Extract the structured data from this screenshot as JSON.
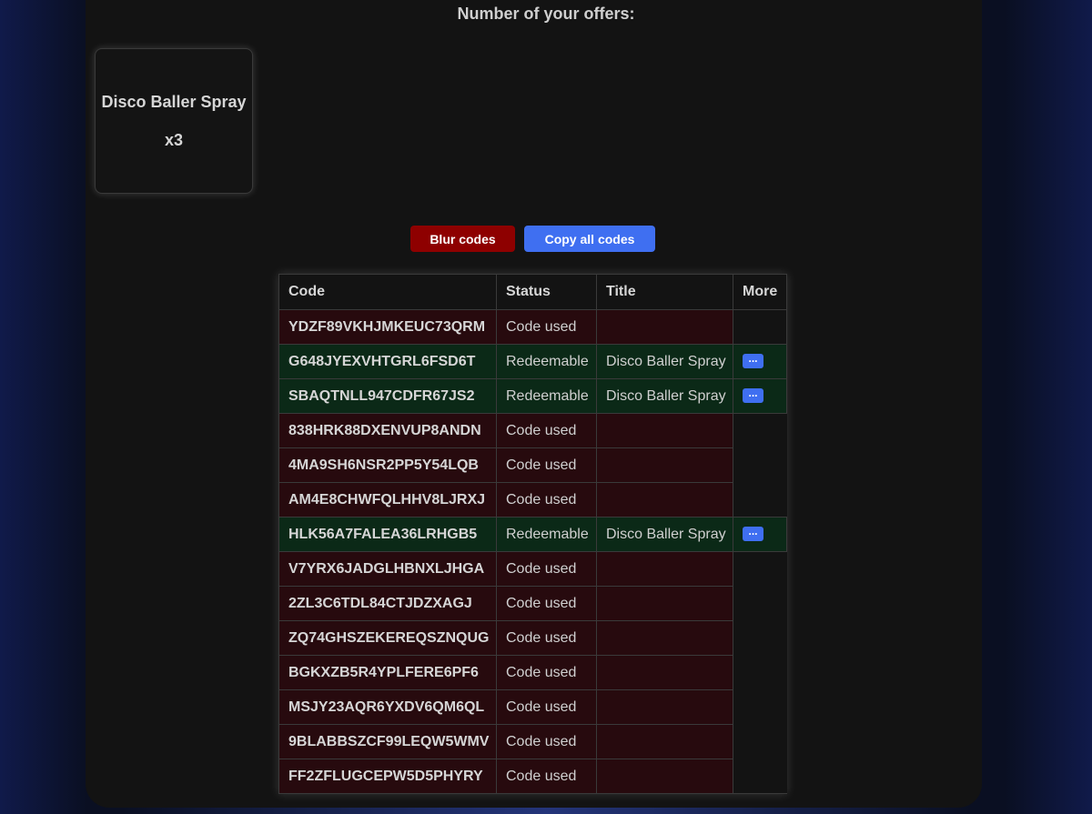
{
  "heading": "Number of your offers:",
  "offer": {
    "title": "Disco Baller Spray",
    "quantity": "x3"
  },
  "buttons": {
    "blur": "Blur codes",
    "copy": "Copy all codes"
  },
  "table": {
    "headers": [
      "Code",
      "Status",
      "Title",
      "More"
    ],
    "more_label": "...",
    "rows": [
      {
        "code": "YDZF89VKHJMKEUC73QRM",
        "status": "Code used",
        "title": ""
      },
      {
        "code": "G648JYEXVHTGRL6FSD6T",
        "status": "Redeemable",
        "title": "Disco Baller Spray"
      },
      {
        "code": "SBAQTNLL947CDFR67JS2",
        "status": "Redeemable",
        "title": "Disco Baller Spray"
      },
      {
        "code": "838HRK88DXENVUP8ANDN",
        "status": "Code used",
        "title": ""
      },
      {
        "code": "4MA9SH6NSR2PP5Y54LQB",
        "status": "Code used",
        "title": ""
      },
      {
        "code": "AM4E8CHWFQLHHV8LJRXJ",
        "status": "Code used",
        "title": ""
      },
      {
        "code": "HLK56A7FALEA36LRHGB5",
        "status": "Redeemable",
        "title": "Disco Baller Spray"
      },
      {
        "code": "V7YRX6JADGLHBNXLJHGA",
        "status": "Code used",
        "title": ""
      },
      {
        "code": "2ZL3C6TDL84CTJDZXAGJ",
        "status": "Code used",
        "title": ""
      },
      {
        "code": "ZQ74GHSZEKEREQSZNQUG",
        "status": "Code used",
        "title": ""
      },
      {
        "code": "BGKXZB5R4YPLFERE6PF6",
        "status": "Code used",
        "title": ""
      },
      {
        "code": "MSJY23AQR6YXDV6QM6QL",
        "status": "Code used",
        "title": ""
      },
      {
        "code": "9BLABBSZCF99LEQW5WMV",
        "status": "Code used",
        "title": ""
      },
      {
        "code": "FF2ZFLUGCEPW5D5PHYRY",
        "status": "Code used",
        "title": ""
      }
    ]
  }
}
